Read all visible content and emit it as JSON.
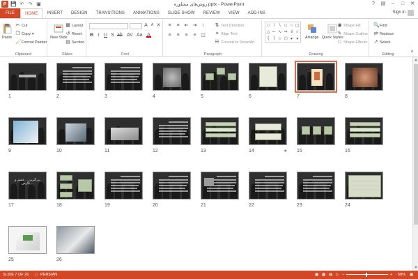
{
  "window": {
    "title": "روش‌های مشاوره.pptx - PowerPoint",
    "app_icon": "P"
  },
  "quick_access": [
    "save-icon",
    "undo-icon",
    "redo-icon",
    "start-show-icon"
  ],
  "tabs": [
    {
      "label": "FILE",
      "kind": "file"
    },
    {
      "label": "HOME",
      "kind": "active"
    },
    {
      "label": "INSERT"
    },
    {
      "label": "DESIGN"
    },
    {
      "label": "TRANSITIONS"
    },
    {
      "label": "ANIMATIONS"
    },
    {
      "label": "SLIDE SHOW"
    },
    {
      "label": "REVIEW"
    },
    {
      "label": "VIEW"
    },
    {
      "label": "ADD-INS"
    }
  ],
  "account": {
    "signin_label": "Sign in"
  },
  "ribbon": {
    "clipboard": {
      "label": "Clipboard",
      "paste": "Paste",
      "cut": "Cut",
      "copy": "Copy",
      "format_painter": "Format Painter"
    },
    "slides": {
      "label": "Slides",
      "new_slide": "New Slide",
      "layout": "Layout",
      "reset": "Reset",
      "section": "Section"
    },
    "font": {
      "label": "Font"
    },
    "paragraph": {
      "label": "Paragraph",
      "text_direction": "Text Direction",
      "align_text": "Align Text",
      "convert_smartart": "Convert to SmartArt"
    },
    "drawing": {
      "label": "Drawing",
      "arrange": "Arrange",
      "quick_styles": "Quick Styles",
      "shape_fill": "Shape Fill",
      "shape_outline": "Shape Outline",
      "shape_effects": "Shape Effects"
    },
    "editing": {
      "label": "Editing",
      "find": "Find",
      "replace": "Replace",
      "select": "Select"
    }
  },
  "slides": [
    {
      "n": "1",
      "type": "title"
    },
    {
      "n": "2",
      "type": "text"
    },
    {
      "n": "3",
      "type": "text"
    },
    {
      "n": "4",
      "type": "photo-grey"
    },
    {
      "n": "5",
      "type": "diagram"
    },
    {
      "n": "6",
      "type": "card"
    },
    {
      "n": "7",
      "type": "cartoon",
      "selected": true
    },
    {
      "n": "8",
      "type": "photo-hands"
    },
    {
      "n": "9",
      "type": "photo-kids"
    },
    {
      "n": "10",
      "type": "photo-handshake"
    },
    {
      "n": "11",
      "type": "photo-book"
    },
    {
      "n": "12",
      "type": "text"
    },
    {
      "n": "13",
      "type": "table"
    },
    {
      "n": "14",
      "type": "boxes",
      "star": true
    },
    {
      "n": "15",
      "type": "flow"
    },
    {
      "n": "16",
      "type": "table"
    },
    {
      "n": "17",
      "type": "bigtext",
      "text": "بزرگترین ... عشق و نگرش ..."
    },
    {
      "n": "18",
      "type": "flowchart"
    },
    {
      "n": "19",
      "type": "text"
    },
    {
      "n": "20",
      "type": "text"
    },
    {
      "n": "21",
      "type": "textphoto"
    },
    {
      "n": "22",
      "type": "text"
    },
    {
      "n": "23",
      "type": "text"
    },
    {
      "n": "24",
      "type": "framed"
    },
    {
      "n": "25",
      "type": "white-photo"
    },
    {
      "n": "26",
      "type": "photo-laptop"
    }
  ],
  "status": {
    "slide_of": "SLIDE 7 OF 26",
    "language": "PERSIAN",
    "zoom": "58%"
  }
}
